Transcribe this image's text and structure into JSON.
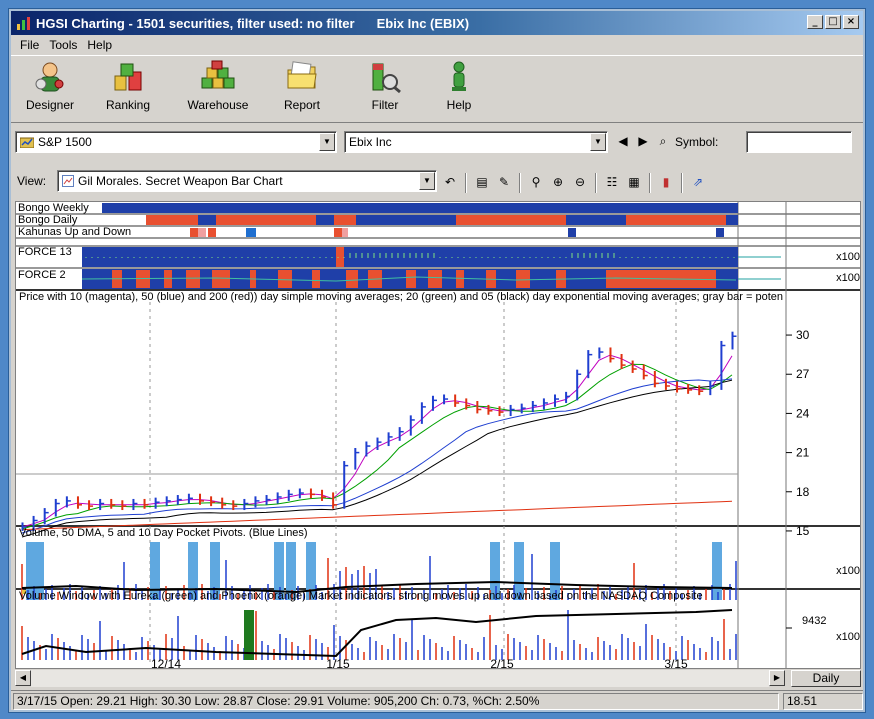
{
  "window": {
    "title": "HGSI Charting - 1501 securities, filter used: no filter",
    "security_title": "Ebix Inc (EBIX)",
    "buttons": {
      "minimize": "_",
      "maximize": "□",
      "close": "×"
    }
  },
  "menu": [
    "File",
    "Tools",
    "Help"
  ],
  "toolbar": {
    "buttons": [
      {
        "label": "Designer",
        "icon": "designer-icon"
      },
      {
        "label": "Ranking",
        "icon": "ranking-icon"
      },
      {
        "label": "Warehouse",
        "icon": "warehouse-icon"
      },
      {
        "label": "Report",
        "icon": "report-folder-icon"
      },
      {
        "label": "Filter",
        "icon": "filter-icon"
      },
      {
        "label": "Help",
        "icon": "help-person-icon"
      }
    ]
  },
  "selectors": {
    "universe": "S&P 1500",
    "security": "Ebix Inc",
    "symbol_label": "Symbol:",
    "symbol_value": ""
  },
  "view": {
    "label": "View:",
    "selected": "Gil Morales. Secret Weapon Bar Chart"
  },
  "indicator_panels": {
    "labels": [
      "Bongo Weekly",
      "Bongo Daily",
      "Kahunas Up and Down",
      "FORCE 13",
      "FORCE 2"
    ],
    "scale": [
      "x100",
      "x100"
    ]
  },
  "price_panel": {
    "title": "Price with 10 (magenta), 50 (blue) and 200 (red)) day simple moving averages; 20 (green) and 05 (black) day exponential moving averages; gray bar = poten",
    "ticks": [
      "30",
      "27",
      "24",
      "21",
      "18",
      "15"
    ]
  },
  "volume_panel": {
    "title": "Volume, 50 DMA, 5 and 10 Day Pocket Pivots. (Blue Lines)",
    "scale": "x100"
  },
  "market_panel": {
    "title": "Volume Window with Eureka (green) and Phoenix (orange) Market indicators. strong moves up and down based on the NASDAQ Composite",
    "tick": "9432",
    "scale": "x100"
  },
  "x_axis": [
    "12/14",
    "1/15",
    "2/15",
    "3/15"
  ],
  "period": "Daily",
  "status": {
    "text": "3/17/15 Open: 29.21 High: 30.30 Low: 28.87 Close: 29.91 Volume: 905,200 Ch: 0.73, %Ch: 2.50%",
    "price": "18.51"
  },
  "chart_data": {
    "type": "bar",
    "title": "",
    "x_ticks": [
      "12/14",
      "1/15",
      "2/15",
      "3/15"
    ],
    "y_ticks": [
      15,
      18,
      21,
      24,
      27,
      30
    ],
    "ylim": [
      14,
      31
    ],
    "approx_close": [
      15.3,
      15.8,
      16.4,
      17.1,
      17.3,
      17.0,
      16.9,
      17.1,
      17.0,
      16.9,
      17.1,
      17.0,
      17.2,
      17.3,
      17.4,
      17.5,
      17.3,
      17.2,
      17.0,
      16.9,
      17.1,
      17.3,
      17.4,
      17.6,
      17.8,
      17.9,
      17.8,
      17.6,
      17.0,
      20.0,
      21.0,
      21.5,
      21.8,
      22.2,
      22.6,
      23.5,
      24.5,
      25.0,
      25.1,
      24.8,
      24.6,
      24.3,
      24.2,
      24.1,
      24.3,
      24.4,
      24.6,
      24.8,
      25.1,
      25.3,
      27.0,
      28.5,
      28.7,
      28.2,
      27.7,
      27.4,
      26.9,
      26.3,
      26.1,
      25.9,
      25.8,
      25.7,
      26.1,
      29.2,
      29.91
    ],
    "colors": {
      "ma10": "#c000c0",
      "ma50": "#1f3fd0",
      "ma200": "#e03010",
      "ema20": "#00a000",
      "ema05": "#000000",
      "up_bar": "#1f3fd0",
      "down_bar": "#e03010",
      "pivot": "#5fa8e0",
      "eureka": "#1f7a1f"
    }
  }
}
